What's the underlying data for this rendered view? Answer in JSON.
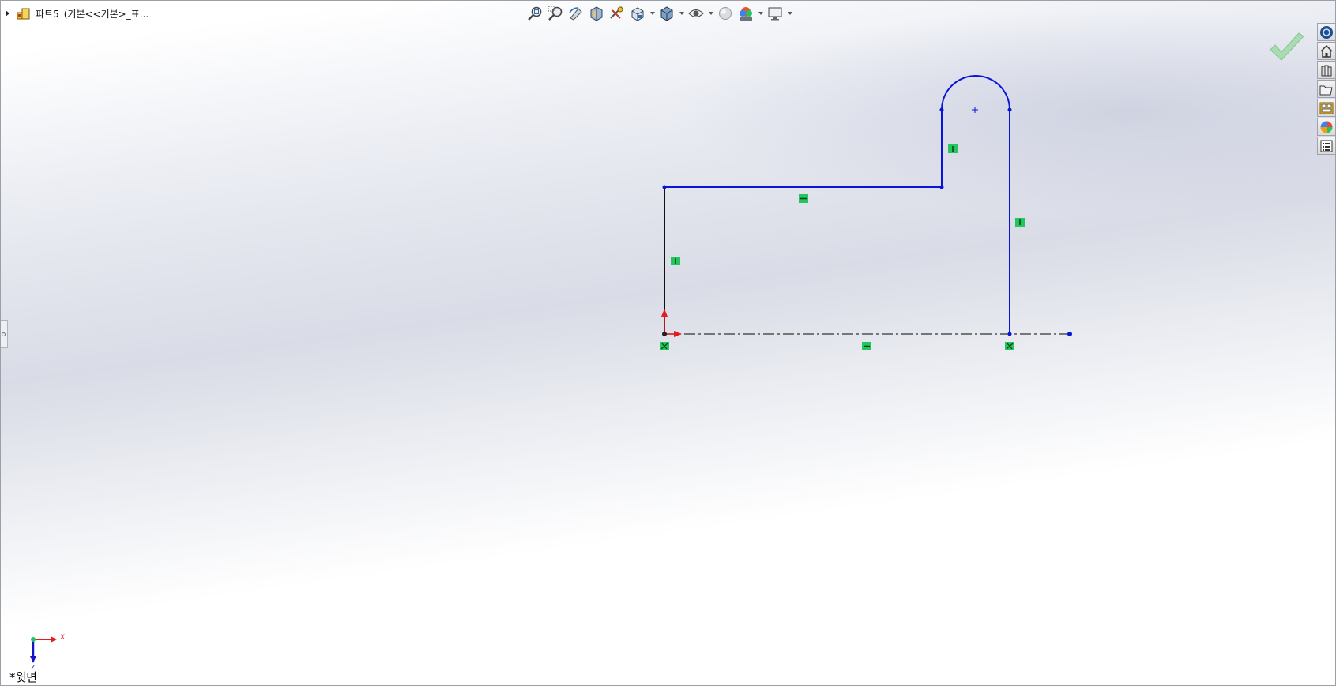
{
  "feature_tree": {
    "part_label": "파트5",
    "config_label": "(기본<<기본>_표..."
  },
  "hud_toolbar": {
    "buttons": [
      "zoom-to-fit-icon",
      "zoom-to-area-icon",
      "previous-view-icon",
      "section-view-icon",
      "dynamic-annotation-icon",
      "view-orientation-icon",
      "display-style-icon",
      "hide-show-items-icon",
      "edit-appearance-icon",
      "apply-scene-icon",
      "view-settings-icon"
    ]
  },
  "task_pane": {
    "tabs": [
      "solidworks-resources-icon",
      "home-icon",
      "design-library-icon",
      "file-explorer-icon",
      "view-palette-icon",
      "appearances-icon",
      "custom-properties-icon"
    ]
  },
  "view_label": "*윗면",
  "triad": {
    "x_label": "X",
    "z_label": "Z"
  },
  "colors": {
    "sketch_line": "#0a14d8",
    "fixed_line": "#111111",
    "relation_badge": "#22c55e",
    "origin_arrow": "#e11d1d",
    "confirm_check": "#9fd6a6"
  }
}
